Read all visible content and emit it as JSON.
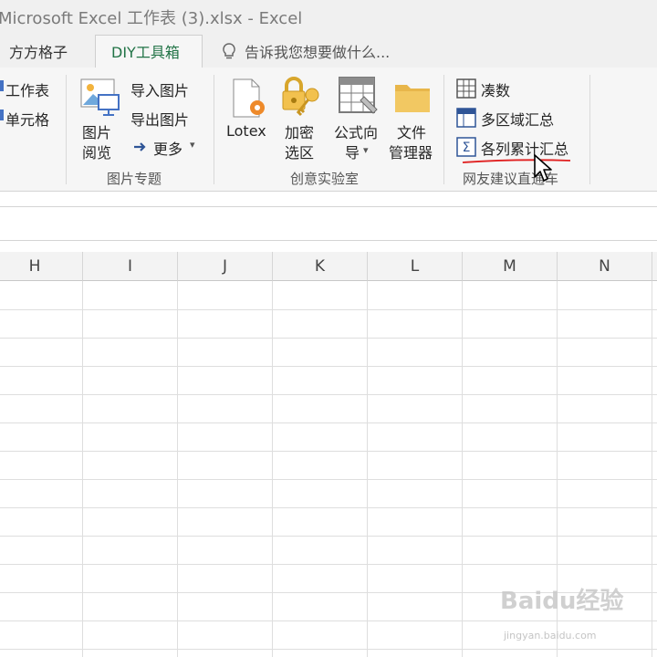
{
  "window": {
    "title": "Microsoft Excel 工作表 (3).xlsx - Excel"
  },
  "tabs": [
    {
      "label": "方方格子"
    },
    {
      "label": "DIY工具箱",
      "active": true
    }
  ],
  "tell_me": {
    "text": "告诉我您想要做什么..."
  },
  "ribbon": {
    "partial_group": {
      "items": [
        "工作表",
        "单元格"
      ]
    },
    "picture_group": {
      "label": "图片专题",
      "preview_button": [
        "图片",
        "阅览"
      ],
      "import_label": "导入图片",
      "export_label": "导出图片",
      "more_label": "更多"
    },
    "lab_group": {
      "label": "创意实验室",
      "lotex_label": "Lotex",
      "encrypt_label": [
        "加密",
        "选区"
      ],
      "formula_wizard_label": [
        "公式向",
        "导"
      ],
      "file_manager_label": [
        "文件",
        "管理器"
      ]
    },
    "netfriend_group": {
      "label": "网友建议直通车",
      "items": [
        "凑数",
        "多区域汇总",
        "各列累计汇总"
      ]
    }
  },
  "grid": {
    "columns": [
      "H",
      "I",
      "J",
      "K",
      "L",
      "M",
      "N"
    ]
  },
  "colors": {
    "accent": "#217346",
    "annotation": "#e02020",
    "folder": "#e8b64a"
  },
  "watermark": {
    "text": "Baidu经验",
    "sub": "jingyan.baidu.com"
  }
}
